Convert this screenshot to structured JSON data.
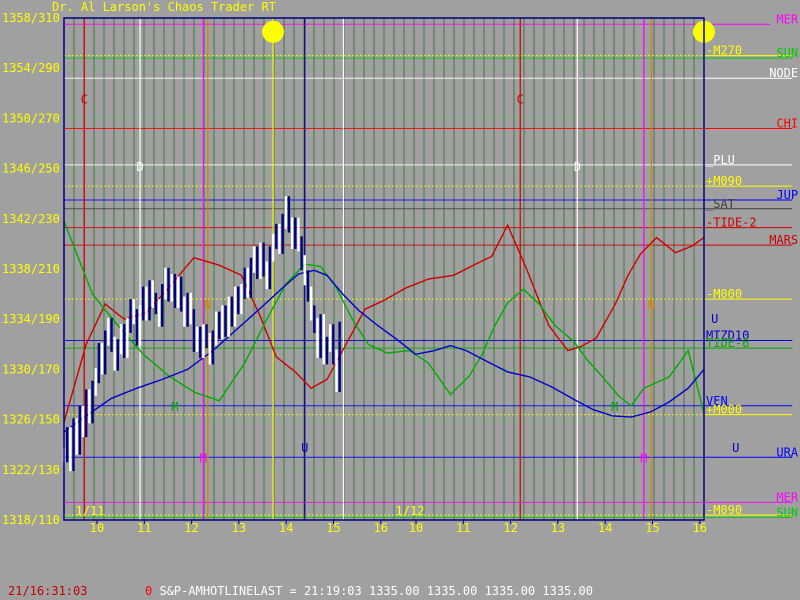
{
  "title": "Dr. Al Larson's Chaos Trader RT",
  "status": {
    "time": "21/16:31:03",
    "prefix": "0",
    "line": "S&P-AMHOTLINELAST = 21:19:03 1335.00 1335.00 1335.00 1335.00"
  },
  "colors": {
    "background": "#a0a0a0",
    "price_bars": "#000080",
    "price_ticks": "#ffffff",
    "tide2": "#cc0000",
    "tide6": "#00aa00",
    "mtzd10": "#0000cc"
  },
  "chart_data": {
    "type": "line",
    "x_tick_labels": [
      "10",
      "11",
      "12",
      "13",
      "14",
      "15",
      "16",
      "10",
      "11",
      "12",
      "13",
      "14",
      "15",
      "16"
    ],
    "date_labels": [
      "1/11",
      "1/12"
    ],
    "y_tick_labels": [
      "1358/310",
      "1354/290",
      "1350/270",
      "1346/250",
      "1342/230",
      "1338/210",
      "1334/190",
      "1330/170",
      "1326/150",
      "1322/130",
      "1318/110"
    ],
    "ylim": [
      1318,
      1358
    ],
    "right_labels": [
      {
        "text": "MER",
        "y": 1357.5,
        "color": "#ff00ff",
        "line_start": 0.72
      },
      {
        "text": "-M270",
        "y": 1355.0,
        "color": "#ffff00",
        "line_start": 0.96
      },
      {
        "text": "SUN",
        "y": 1354.8,
        "color": "#00cc00",
        "line_start": 0.96
      },
      {
        "text": "NODE",
        "y": 1353.2,
        "color": "#ffffff",
        "line_start": 0.96
      },
      {
        "text": "CHI",
        "y": 1349.2,
        "color": "#ff0000",
        "line_start": 0.96
      },
      {
        "text": "_PLU",
        "y": 1346.3,
        "color": "#ffffff",
        "line_start": 0.96
      },
      {
        "text": "+M090",
        "y": 1344.6,
        "color": "#ffff00",
        "line_start": 0.96
      },
      {
        "text": "JUP",
        "y": 1343.5,
        "color": "#0000ff",
        "line_start": 0.96
      },
      {
        "text": "_SAT",
        "y": 1342.8,
        "color": "#404040",
        "line_start": 0.96
      },
      {
        "text": "-TIDE-2",
        "y": 1341.3,
        "color": "#cc0000",
        "line_start": 0.96
      },
      {
        "text": "MARS",
        "y": 1339.9,
        "color": "#cc0000",
        "line_start": 0.96
      },
      {
        "text": "-M000",
        "y": 1335.6,
        "color": "#ffff00",
        "line_start": 0.96
      },
      {
        "text": "MTZD10",
        "y": 1332.3,
        "color": "#0000cc",
        "line_start": 0.96
      },
      {
        "text": "TIDE-6",
        "y": 1331.7,
        "color": "#00aa00",
        "line_start": 0.96
      },
      {
        "text": "VEN",
        "y": 1327.1,
        "color": "#0000ff",
        "line_start": 0.96
      },
      {
        "text": "+M000",
        "y": 1326.4,
        "color": "#ffff00",
        "line_start": 0.96
      },
      {
        "text": "URA",
        "y": 1323.0,
        "color": "#0000ff",
        "line_start": 0.96
      },
      {
        "text": "MER",
        "y": 1319.4,
        "color": "#ff00ff",
        "line_start": 0.96
      },
      {
        "text": "-M090",
        "y": 1318.4,
        "color": "#ffff00",
        "line_start": 0.96
      },
      {
        "text": "SUN",
        "y": 1318.2,
        "color": "#00cc00",
        "line_start": 0.96
      }
    ],
    "event_markers": [
      {
        "text": "C",
        "day": 9.77,
        "y": 1351.2,
        "color": "#cc0000"
      },
      {
        "text": "D",
        "day": 10.65,
        "y": 1345.8,
        "color": "#ffffff"
      },
      {
        "text": "N",
        "day": 11.72,
        "y": 1334.8,
        "color": "#cc8800"
      },
      {
        "text": "M",
        "day": 11.2,
        "y": 1326.7,
        "color": "#00aa00"
      },
      {
        "text": "M",
        "day": 11.65,
        "y": 1322.6,
        "color": "#ff00ff"
      },
      {
        "text": "U",
        "day": 13.25,
        "y": 1323.4,
        "color": "#0000cc"
      },
      {
        "text": "C",
        "day": 16.65,
        "y": 1351.2,
        "color": "#cc0000"
      },
      {
        "text": "D",
        "day": 17.55,
        "y": 1345.8,
        "color": "#ffffff"
      },
      {
        "text": "N",
        "day": 18.72,
        "y": 1334.8,
        "color": "#cc8800"
      },
      {
        "text": "M",
        "day": 18.14,
        "y": 1326.7,
        "color": "#00aa00"
      },
      {
        "text": "M",
        "day": 18.6,
        "y": 1322.6,
        "color": "#ff00ff"
      },
      {
        "text": "U",
        "day": 19.72,
        "y": 1333.7,
        "color": "#0000cc"
      },
      {
        "text": "U",
        "day": 20.05,
        "y": 1323.4,
        "color": "#0000cc"
      }
    ],
    "suns": [
      {
        "day": 12.75,
        "y": 1356.9
      },
      {
        "day": 19.55,
        "y": 1356.9
      }
    ],
    "series": [
      {
        "name": "TIDE-2",
        "color": "#cc0000",
        "points": [
          [
            9.45,
            1325.8
          ],
          [
            9.8,
            1332
          ],
          [
            10.1,
            1335.2
          ],
          [
            10.4,
            1334
          ],
          [
            10.75,
            1334.5
          ],
          [
            11.1,
            1336.5
          ],
          [
            11.5,
            1338.9
          ],
          [
            11.9,
            1338.3
          ],
          [
            12.25,
            1337.5
          ],
          [
            12.55,
            1334.2
          ],
          [
            12.8,
            1331
          ],
          [
            13.1,
            1329.8
          ],
          [
            13.35,
            1328.5
          ],
          [
            13.6,
            1329.2
          ],
          [
            13.9,
            1332
          ],
          [
            14.2,
            1334.8
          ],
          [
            14.5,
            1335.5
          ],
          [
            14.85,
            1336.5
          ],
          [
            15.2,
            1337.2
          ],
          [
            15.6,
            1337.5
          ],
          [
            15.95,
            1338.4
          ],
          [
            16.2,
            1339
          ],
          [
            16.45,
            1341.5
          ],
          [
            16.75,
            1338
          ],
          [
            17.1,
            1333.5
          ],
          [
            17.4,
            1331.5
          ],
          [
            17.6,
            1331.8
          ],
          [
            17.85,
            1332.5
          ],
          [
            18.15,
            1335.2
          ],
          [
            18.35,
            1337.5
          ],
          [
            18.55,
            1339.2
          ],
          [
            18.8,
            1340.5
          ],
          [
            19.1,
            1339.3
          ],
          [
            19.35,
            1339.8
          ],
          [
            19.55,
            1340.5
          ]
        ]
      },
      {
        "name": "TIDE-6",
        "color": "#00aa00",
        "points": [
          [
            9.45,
            1341.8
          ],
          [
            9.9,
            1336
          ],
          [
            10.3,
            1333.5
          ],
          [
            10.7,
            1331.2
          ],
          [
            11.1,
            1329.5
          ],
          [
            11.5,
            1328.2
          ],
          [
            11.9,
            1327.5
          ],
          [
            12.3,
            1330.5
          ],
          [
            12.65,
            1334
          ],
          [
            12.95,
            1336.8
          ],
          [
            13.25,
            1338.4
          ],
          [
            13.5,
            1338.2
          ],
          [
            13.75,
            1336.5
          ],
          [
            14.0,
            1334
          ],
          [
            14.25,
            1332
          ],
          [
            14.55,
            1331.3
          ],
          [
            14.9,
            1331.5
          ],
          [
            15.2,
            1330.5
          ],
          [
            15.55,
            1328
          ],
          [
            15.85,
            1329.5
          ],
          [
            16.05,
            1331.2
          ],
          [
            16.25,
            1333.5
          ],
          [
            16.45,
            1335.3
          ],
          [
            16.7,
            1336.4
          ],
          [
            16.95,
            1335.2
          ],
          [
            17.2,
            1333.5
          ],
          [
            17.5,
            1332.2
          ],
          [
            17.7,
            1330.8
          ],
          [
            17.95,
            1329.4
          ],
          [
            18.2,
            1327.9
          ],
          [
            18.4,
            1327.1
          ],
          [
            18.6,
            1328.5
          ],
          [
            19.0,
            1329.4
          ],
          [
            19.3,
            1331.5
          ],
          [
            19.55,
            1326.5
          ]
        ]
      },
      {
        "name": "MTZD10",
        "color": "#0000cc",
        "points": [
          [
            9.45,
            1325
          ],
          [
            9.8,
            1326.3
          ],
          [
            10.2,
            1327.7
          ],
          [
            10.6,
            1328.5
          ],
          [
            11.0,
            1329.2
          ],
          [
            11.4,
            1330
          ],
          [
            11.8,
            1331.5
          ],
          [
            12.2,
            1333.3
          ],
          [
            12.6,
            1335.1
          ],
          [
            12.9,
            1336.5
          ],
          [
            13.15,
            1337.6
          ],
          [
            13.4,
            1337.9
          ],
          [
            13.6,
            1337.5
          ],
          [
            13.85,
            1336
          ],
          [
            14.1,
            1334.7
          ],
          [
            14.4,
            1333.5
          ],
          [
            14.7,
            1332.4
          ],
          [
            15.0,
            1331.2
          ],
          [
            15.3,
            1331.5
          ],
          [
            15.55,
            1331.9
          ],
          [
            15.8,
            1331.5
          ],
          [
            16.1,
            1330.7
          ],
          [
            16.45,
            1329.8
          ],
          [
            16.8,
            1329.4
          ],
          [
            17.15,
            1328.6
          ],
          [
            17.5,
            1327.6
          ],
          [
            17.8,
            1326.8
          ],
          [
            18.1,
            1326.3
          ],
          [
            18.4,
            1326.2
          ],
          [
            18.7,
            1326.6
          ],
          [
            19.0,
            1327.4
          ],
          [
            19.3,
            1328.5
          ],
          [
            19.55,
            1330
          ]
        ]
      }
    ],
    "price_ticks": [
      [
        9.45,
        1323.2
      ],
      [
        9.5,
        1324.8
      ],
      [
        9.55,
        1322.5
      ],
      [
        9.6,
        1325.5
      ],
      [
        9.65,
        1323.8
      ],
      [
        9.7,
        1326.5
      ],
      [
        9.75,
        1325.2
      ],
      [
        9.8,
        1327.8
      ],
      [
        9.85,
        1326.3
      ],
      [
        9.9,
        1328.5
      ],
      [
        9.95,
        1329.5
      ],
      [
        10.0,
        1331.5
      ],
      [
        10.05,
        1330.2
      ],
      [
        10.1,
        1332.5
      ],
      [
        10.15,
        1333.5
      ],
      [
        10.2,
        1332
      ],
      [
        10.25,
        1330.5
      ],
      [
        10.3,
        1331.8
      ],
      [
        10.35,
        1333
      ],
      [
        10.4,
        1331.5
      ],
      [
        10.45,
        1333.5
      ],
      [
        10.5,
        1335
      ],
      [
        10.55,
        1334.2
      ],
      [
        10.6,
        1332.5
      ],
      [
        10.65,
        1334.5
      ],
      [
        10.7,
        1336
      ],
      [
        10.75,
        1334.5
      ],
      [
        10.8,
        1336.5
      ],
      [
        10.85,
        1335.5
      ],
      [
        10.9,
        1335
      ],
      [
        10.95,
        1334
      ],
      [
        11.0,
        1336.2
      ],
      [
        11.05,
        1337.5
      ],
      [
        11.1,
        1336
      ],
      [
        11.15,
        1337
      ],
      [
        11.2,
        1335.5
      ],
      [
        11.25,
        1336.8
      ],
      [
        11.3,
        1335.2
      ],
      [
        11.35,
        1334
      ],
      [
        11.4,
        1335.5
      ],
      [
        11.45,
        1334.2
      ],
      [
        11.5,
        1332
      ],
      [
        11.55,
        1332.8
      ],
      [
        11.6,
        1331.5
      ],
      [
        11.65,
        1333
      ],
      [
        11.7,
        1332.3
      ],
      [
        11.75,
        1331
      ],
      [
        11.8,
        1332.5
      ],
      [
        11.85,
        1334
      ],
      [
        11.9,
        1333
      ],
      [
        11.95,
        1334.5
      ],
      [
        12.0,
        1333.2
      ],
      [
        12.05,
        1335.2
      ],
      [
        12.1,
        1334
      ],
      [
        12.15,
        1336
      ],
      [
        12.2,
        1335
      ],
      [
        12.25,
        1336.2
      ],
      [
        12.3,
        1337.5
      ],
      [
        12.35,
        1336.3
      ],
      [
        12.4,
        1338.3
      ],
      [
        12.45,
        1339.2
      ],
      [
        12.5,
        1337.8
      ],
      [
        12.55,
        1339.5
      ],
      [
        12.6,
        1338
      ],
      [
        12.65,
        1337
      ],
      [
        12.7,
        1339.2
      ],
      [
        12.75,
        1340.2
      ],
      [
        12.8,
        1341
      ],
      [
        12.85,
        1339.8
      ],
      [
        12.9,
        1341.8
      ],
      [
        12.95,
        1343.2
      ],
      [
        13.0,
        1341.5
      ],
      [
        13.05,
        1340.2
      ],
      [
        13.1,
        1341.5
      ],
      [
        13.15,
        1340
      ],
      [
        13.2,
        1338.5
      ],
      [
        13.25,
        1337.3
      ],
      [
        13.3,
        1336
      ],
      [
        13.35,
        1334.5
      ],
      [
        13.4,
        1333.5
      ],
      [
        13.45,
        1331.5
      ],
      [
        13.5,
        1333.8
      ],
      [
        13.55,
        1331
      ],
      [
        13.6,
        1332
      ],
      [
        13.65,
        1333
      ],
      [
        13.7,
        1331
      ],
      [
        13.75,
        1328.8
      ],
      [
        13.8,
        1333.2
      ]
    ]
  }
}
